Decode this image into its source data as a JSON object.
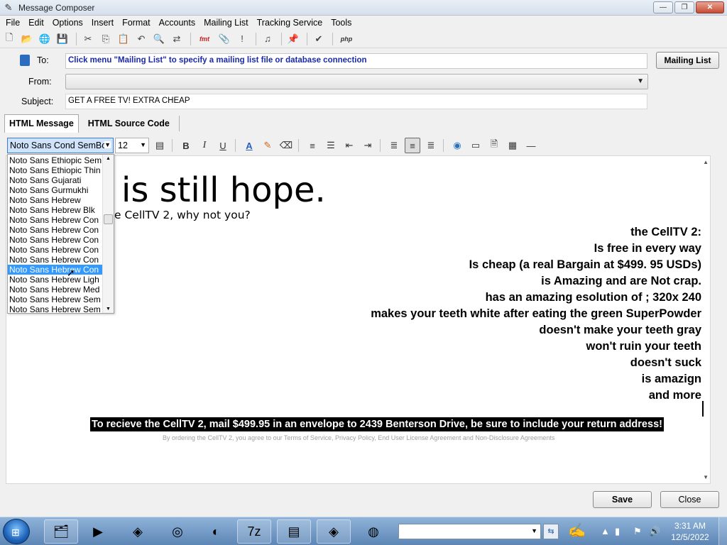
{
  "window": {
    "title": "Message Composer",
    "minimize_glyph": "—",
    "restore_glyph": "❐",
    "close_glyph": "✕"
  },
  "menu": [
    "File",
    "Edit",
    "Options",
    "Insert",
    "Format",
    "Accounts",
    "Mailing List",
    "Tracking Service",
    "Tools"
  ],
  "toolbar": {
    "fmt_label": "fmt",
    "php_label": "php",
    "icons": [
      "new-icon",
      "open-icon",
      "globe-icon",
      "save-icon",
      "cut-icon",
      "copy-icon",
      "paste-icon",
      "undo-icon",
      "find-icon",
      "replace-icon",
      "fmt-icon",
      "attach-icon",
      "importance-icon",
      "music-icon",
      "pin-icon",
      "spellcheck-icon",
      "php-icon"
    ]
  },
  "fields": {
    "to_label": "To:",
    "to_value": "Click menu \"Mailing List\" to specify a mailing list file or database connection",
    "mailing_list_button": "Mailing List",
    "from_label": "From:",
    "from_value": "",
    "subject_label": "Subject:",
    "subject_value": "GET A FREE TV! EXTRA CHEAP"
  },
  "tabs": {
    "html_message": "HTML Message",
    "html_source": "HTML Source Code"
  },
  "format_bar": {
    "font_value": "Noto Sans Cond SemBo",
    "size_value": "12",
    "bold": "B",
    "italic": "I",
    "underline": "U",
    "font_color": "A"
  },
  "font_list": {
    "options": [
      "Noto Sans Ethiopic Sem",
      "Noto Sans Ethiopic Thin",
      "Noto Sans Gujarati",
      "Noto Sans Gurmukhi",
      "Noto Sans Hebrew",
      "Noto Sans Hebrew Blk",
      "Noto Sans Hebrew Con",
      "Noto Sans Hebrew Con",
      "Noto Sans Hebrew Con",
      "Noto Sans Hebrew Con",
      "Noto Sans Hebrew Con",
      "Noto Sans Hebrew Con",
      "Noto Sans Hebrew Ligh",
      "Noto Sans Hebrew Med",
      "Noto Sans Hebrew Sem",
      "Noto Sans Hebrew Sem"
    ],
    "selected_index": 11
  },
  "editor": {
    "headline": "is still hope.",
    "subline": "e CellTV 2, why not you?",
    "features": [
      "the CellTV 2:",
      "Is free in every way",
      "Is cheap (a real Bargain at $499. 95 USDs)",
      "is Amazing and are Not crap.",
      "has an amazing esolution of ; 320x 240",
      "makes your teeth white after eating the green SuperPowder",
      "doesn't make your teeth gray",
      "won't ruin your teeth",
      "doesn't suck",
      "is amazign",
      "and more"
    ],
    "promo": "To recieve the CellTV 2, mail $499.95 in an envelope to 2439 Benterson Drive, be sure to include your return address!",
    "fine_print": "By ordering the CellTV 2, you agree to our Terms of Service, Privacy Policy, End User License Agreement and Non-Disclosure Agreements"
  },
  "buttons": {
    "save": "Save",
    "close": "Close"
  },
  "taskbar": {
    "time": "3:31 AM",
    "date": "12/5/2022",
    "apps": [
      "explorer-icon",
      "media-player-icon",
      "app-icon",
      "chrome-icon",
      "firefox-icon",
      "7zip-icon",
      "control-panel-icon",
      "app-icon-2",
      "network-icon"
    ]
  },
  "colors": {
    "to_text": "#1a2aa8",
    "selection": "#3399ff",
    "promo_bg": "#000000",
    "taskbar": "#6b93c2"
  }
}
